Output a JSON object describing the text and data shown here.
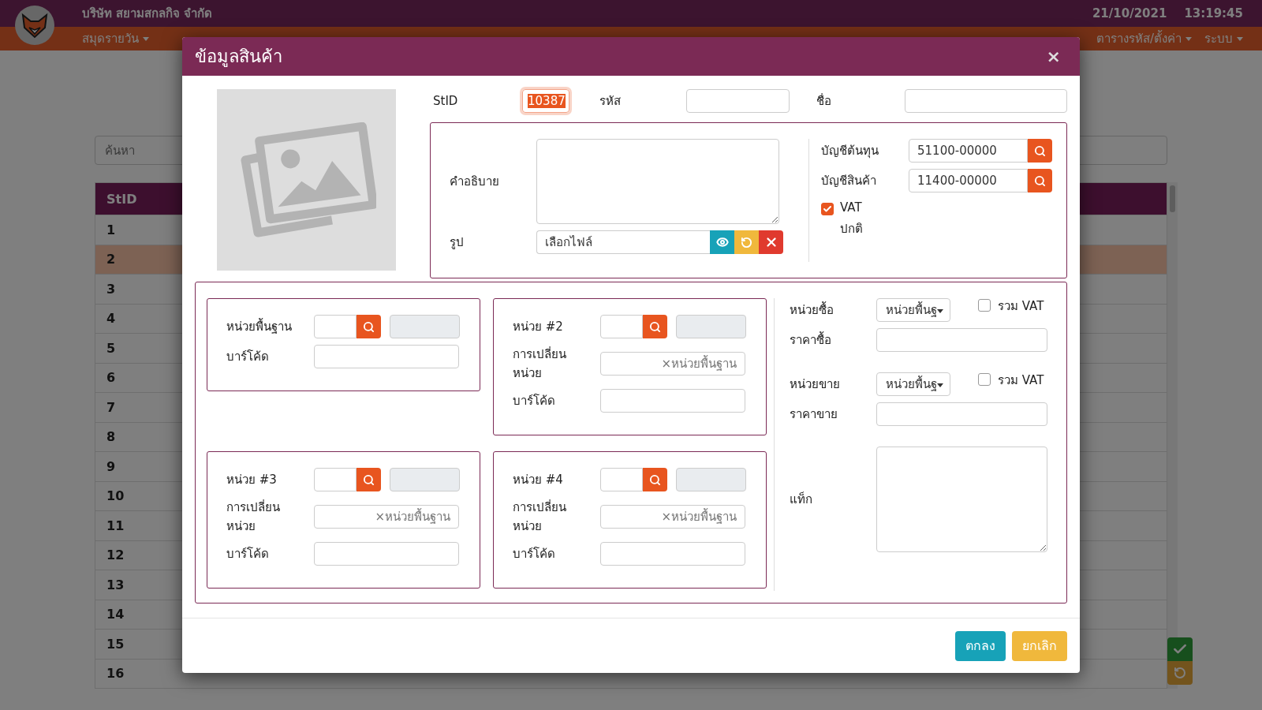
{
  "header": {
    "company": "บริษัท สยามสกลกิจ จำกัด",
    "date": "21/10/2021",
    "time": "13:19:45"
  },
  "menu": {
    "left": [
      {
        "label": "สมุดรายวัน"
      }
    ],
    "right": [
      {
        "label": "ตารางรหัส/ตั้งค่า"
      },
      {
        "label": "ระบบ"
      }
    ]
  },
  "list": {
    "search_placeholder": "ค้นหา",
    "columns": [
      "StID"
    ],
    "rows": [
      {
        "stid": "1",
        "selected": false
      },
      {
        "stid": "2",
        "selected": true
      },
      {
        "stid": "3",
        "selected": false
      },
      {
        "stid": "4",
        "selected": false
      },
      {
        "stid": "5",
        "selected": false
      },
      {
        "stid": "6",
        "selected": false
      },
      {
        "stid": "7",
        "selected": false
      },
      {
        "stid": "8",
        "selected": false
      },
      {
        "stid": "9",
        "selected": false
      },
      {
        "stid": "10",
        "selected": false
      },
      {
        "stid": "11",
        "selected": false
      },
      {
        "stid": "12",
        "selected": false
      },
      {
        "stid": "13",
        "selected": false
      },
      {
        "stid": "14",
        "selected": false
      },
      {
        "stid": "15",
        "selected": false
      },
      {
        "stid": "16",
        "selected": false
      }
    ]
  },
  "dialog": {
    "title": "ข้อมูลสินค้า",
    "close": "×",
    "top_fields": [
      {
        "label": "StID",
        "value": "10387"
      },
      {
        "label": "รหัส"
      },
      {
        "label": "ชื่อ"
      }
    ],
    "description_label": "คำอธิบาย",
    "picture_label": "รูป",
    "file_placeholder": "เลือกไฟล์",
    "accounts": [
      {
        "label": "บัญชีต้นทุน",
        "value": "51100-00000"
      },
      {
        "label": "บัญชีสินค้า",
        "value": "11400-00000"
      }
    ],
    "vat": {
      "label": "VAT",
      "checked": true,
      "note": "ปกติ"
    },
    "units": [
      {
        "kind": "base",
        "label": "หน่วยพื้นฐาน",
        "barcode_label": "บาร์โค้ด"
      },
      {
        "kind": "derived",
        "label": "หน่วย #2",
        "conversion_label": "การเปลี่ยนหน่วย",
        "conversion_placeholder": "×หน่วยพื้นฐาน",
        "barcode_label": "บาร์โค้ด"
      },
      {
        "kind": "derived",
        "label": "หน่วย #3",
        "conversion_label": "การเปลี่ยนหน่วย",
        "conversion_placeholder": "×หน่วยพื้นฐาน",
        "barcode_label": "บาร์โค้ด"
      },
      {
        "kind": "derived",
        "label": "หน่วย #4",
        "conversion_label": "การเปลี่ยนหน่วย",
        "conversion_placeholder": "×หน่วยพื้นฐาน",
        "barcode_label": "บาร์โค้ด"
      }
    ],
    "pricing": [
      {
        "unit_label": "หน่วยซื้อ",
        "unit_value": "หน่วยพื้นฐ",
        "vat_label": "รวม VAT",
        "vat_checked": false,
        "price_label": "ราคาซื้อ"
      },
      {
        "unit_label": "หน่วยขาย",
        "unit_value": "หน่วยพื้นฐ",
        "vat_label": "รวม VAT",
        "vat_checked": false,
        "price_label": "ราคาขาย"
      }
    ],
    "tag_label": "แท็ก",
    "buttons": [
      {
        "label": "ตกลง",
        "kind": "primary"
      },
      {
        "label": "ยกเลิก",
        "kind": "cancel"
      }
    ]
  }
}
